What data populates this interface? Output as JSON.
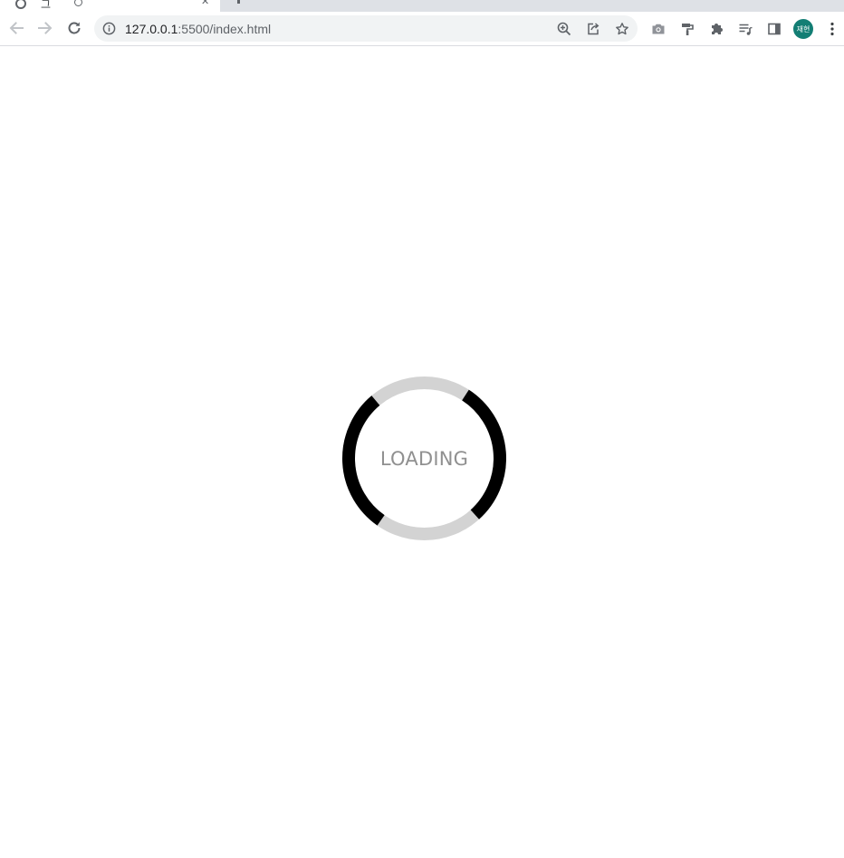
{
  "browser": {
    "tab_title_fragment": "그",
    "address_bar": {
      "host": "127.0.0.1",
      "path": ":5500/index.html"
    },
    "profile_initials": "재현"
  },
  "page": {
    "loading_text": "LOADING",
    "colors": {
      "spinner_track": "#d3d3d3",
      "spinner_arc": "#000000",
      "loading_text": "#909090",
      "avatar_bg": "#137e74"
    }
  }
}
